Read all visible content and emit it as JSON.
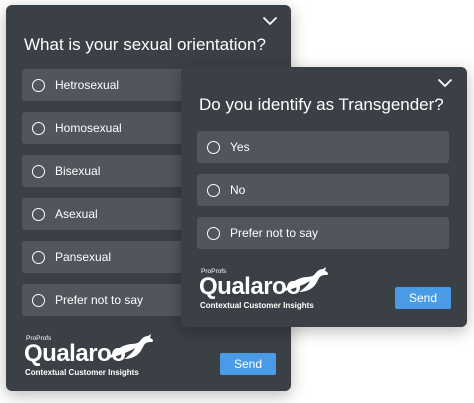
{
  "survey_orientation": {
    "question": "What is your sexual orientation?",
    "options": [
      {
        "label": "Hetrosexual"
      },
      {
        "label": "Homosexual"
      },
      {
        "label": "Bisexual"
      },
      {
        "label": "Asexual"
      },
      {
        "label": "Pansexual"
      },
      {
        "label": "Prefer not to say"
      }
    ],
    "send_label": "Send",
    "brand": {
      "proprofs": "ProProfs",
      "name": "Qualaroo",
      "tagline": "Contextual Customer Insights"
    }
  },
  "survey_transgender": {
    "question": "Do you identify as Transgender?",
    "options": [
      {
        "label": "Yes"
      },
      {
        "label": "No"
      },
      {
        "label": "Prefer not to say"
      }
    ],
    "send_label": "Send",
    "brand": {
      "proprofs": "ProProfs",
      "name": "Qualaroo",
      "tagline": "Contextual Customer Insights"
    }
  },
  "colors": {
    "panel": "#3b3f46",
    "option": "#51555d",
    "accent": "#4a9be5"
  },
  "icons": [
    "chevron-down-icon",
    "radio-unselected-icon",
    "kangaroo-logo-icon"
  ]
}
